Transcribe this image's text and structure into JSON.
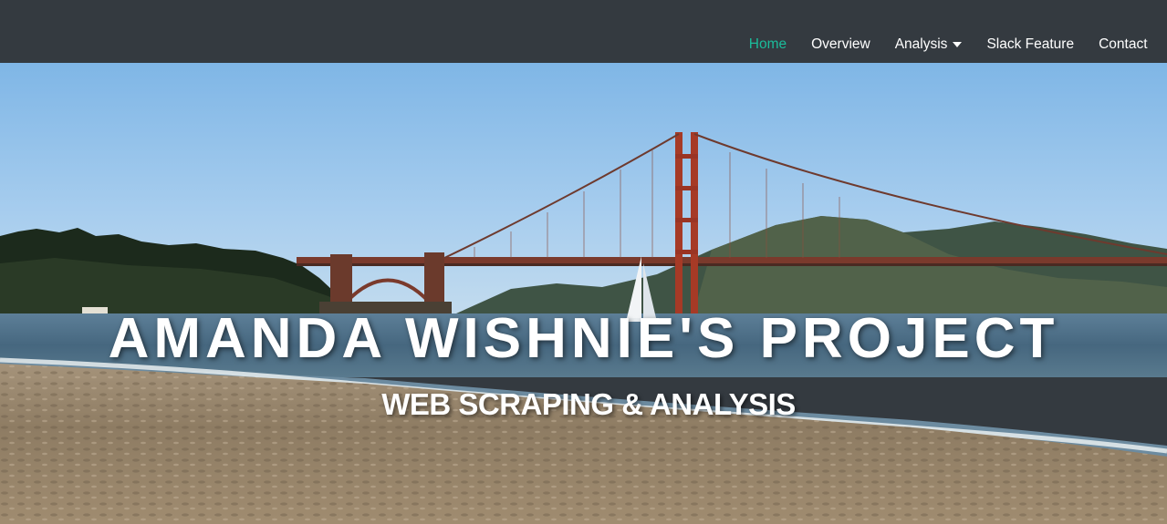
{
  "nav": {
    "items": [
      {
        "label": "Home",
        "active": true
      },
      {
        "label": "Overview",
        "active": false
      },
      {
        "label": "Analysis",
        "active": false,
        "dropdown": true
      },
      {
        "label": "Slack Feature",
        "active": false
      },
      {
        "label": "Contact",
        "active": false
      }
    ]
  },
  "hero": {
    "title": "AMANDA WISHNIE'S PROJECT",
    "subtitle": "WEB SCRAPING & ANALYSIS",
    "image": "golden-gate-bridge-beach-photo"
  },
  "colors": {
    "navbar_bg": "#343a40",
    "active_link": "#1bbc9b",
    "link": "#ffffff"
  }
}
